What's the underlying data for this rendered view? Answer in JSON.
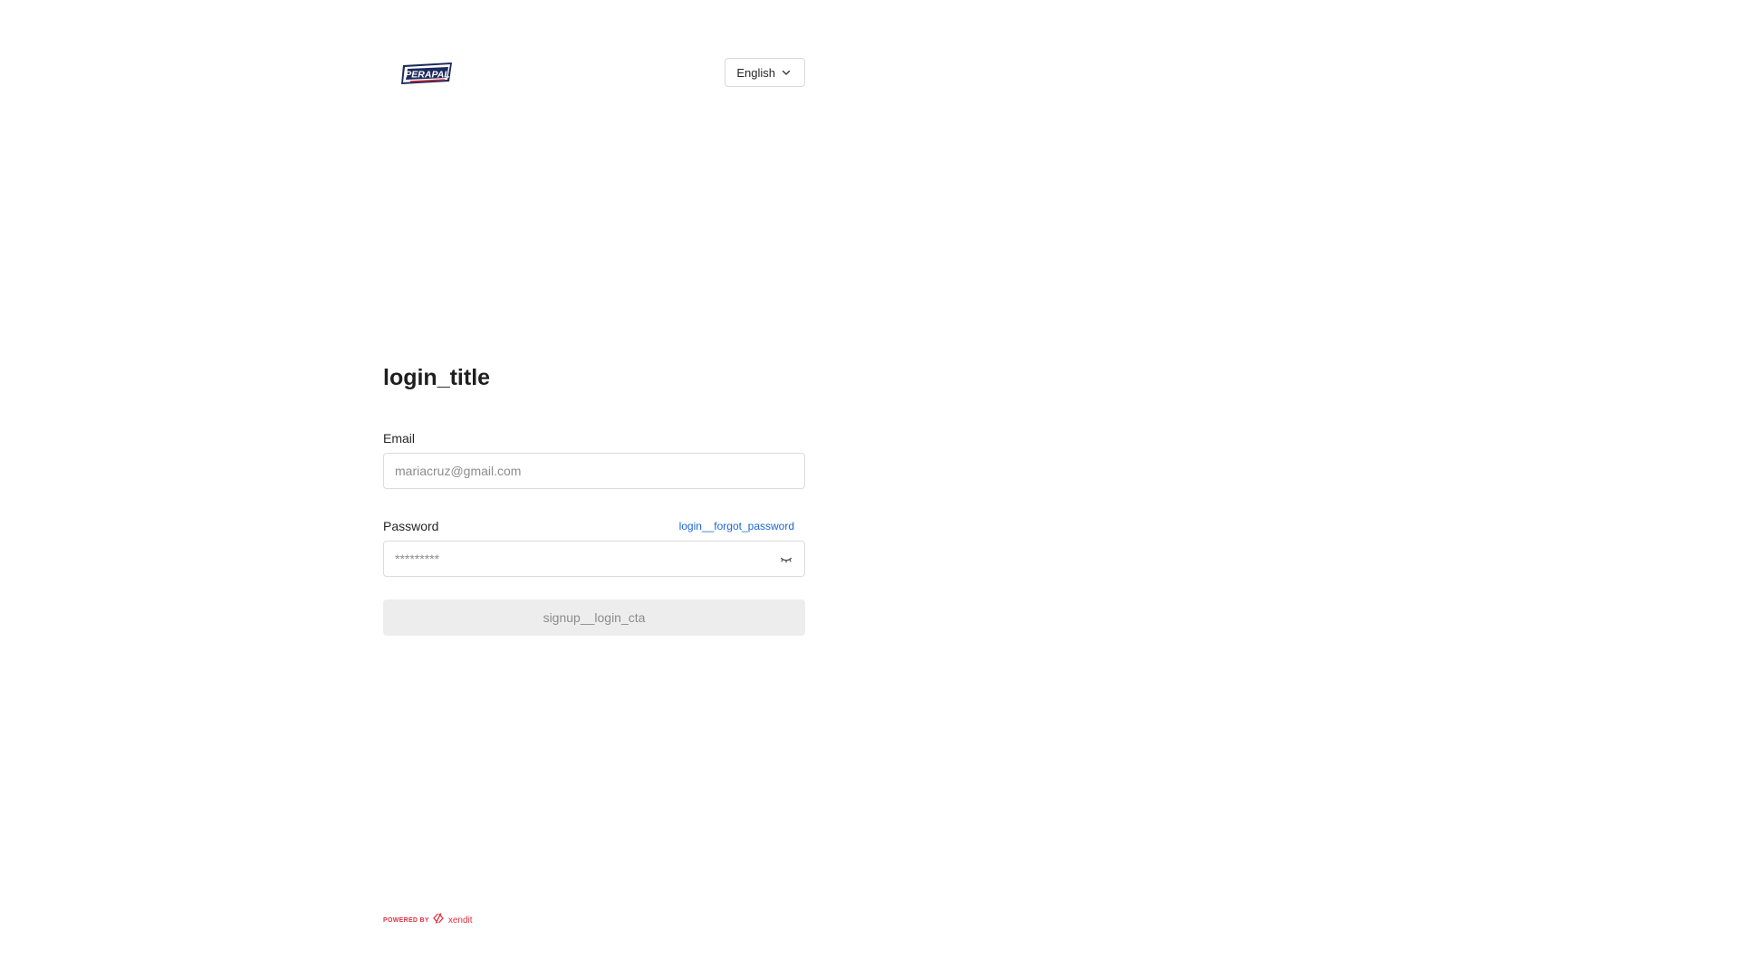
{
  "header": {
    "logo_text": "PERAPAL",
    "language": {
      "selected": "English"
    }
  },
  "form": {
    "title": "login_title",
    "email": {
      "label": "Email",
      "placeholder": "mariacruz@gmail.com"
    },
    "password": {
      "label": "Password",
      "placeholder": "*********",
      "forgot_link": "login__forgot_password"
    },
    "submit_label": "signup__login_cta",
    "submit_disabled": true
  },
  "footer": {
    "powered_prefix": "POWERED BY",
    "powered_brand": "xendit"
  },
  "colors": {
    "link": "#1a66d6",
    "disabled_button_bg": "#ededed",
    "disabled_button_text": "#8c8c8c",
    "input_border": "#dcdcdc",
    "xendit_red": "#e0303f"
  }
}
